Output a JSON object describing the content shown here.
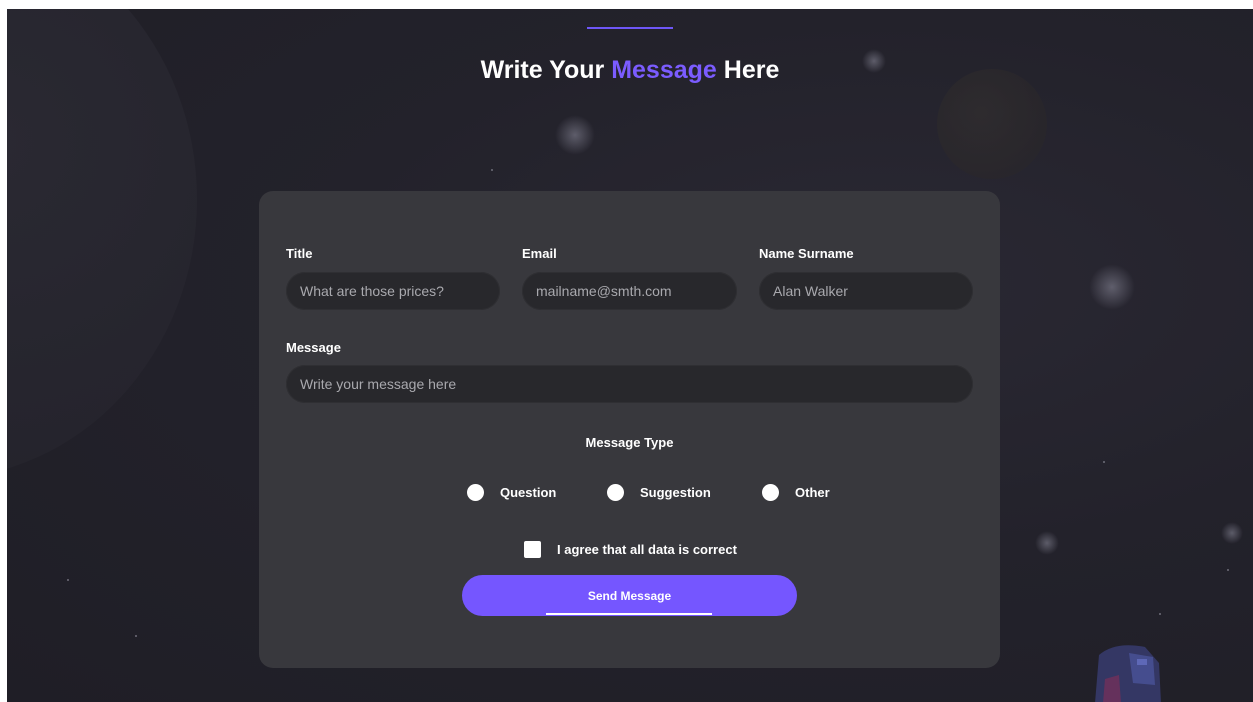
{
  "heading": {
    "prefix": "Write Your ",
    "accent": "Message",
    "suffix": " Here"
  },
  "form": {
    "title": {
      "label": "Title",
      "placeholder": "What are those prices?"
    },
    "email": {
      "label": "Email",
      "placeholder": "mailname@smth.com"
    },
    "name": {
      "label": "Name Surname",
      "placeholder": "Alan Walker"
    },
    "message": {
      "label": "Message",
      "placeholder": "Write your message here"
    },
    "message_type": {
      "label": "Message Type",
      "options": [
        "Question",
        "Suggestion",
        "Other"
      ]
    },
    "agree_label": "I agree that all data is correct",
    "submit_label": "Send Message"
  },
  "colors": {
    "accent": "#7556ff",
    "background": "#23222b",
    "card": "#38383d",
    "input": "#28282c"
  }
}
